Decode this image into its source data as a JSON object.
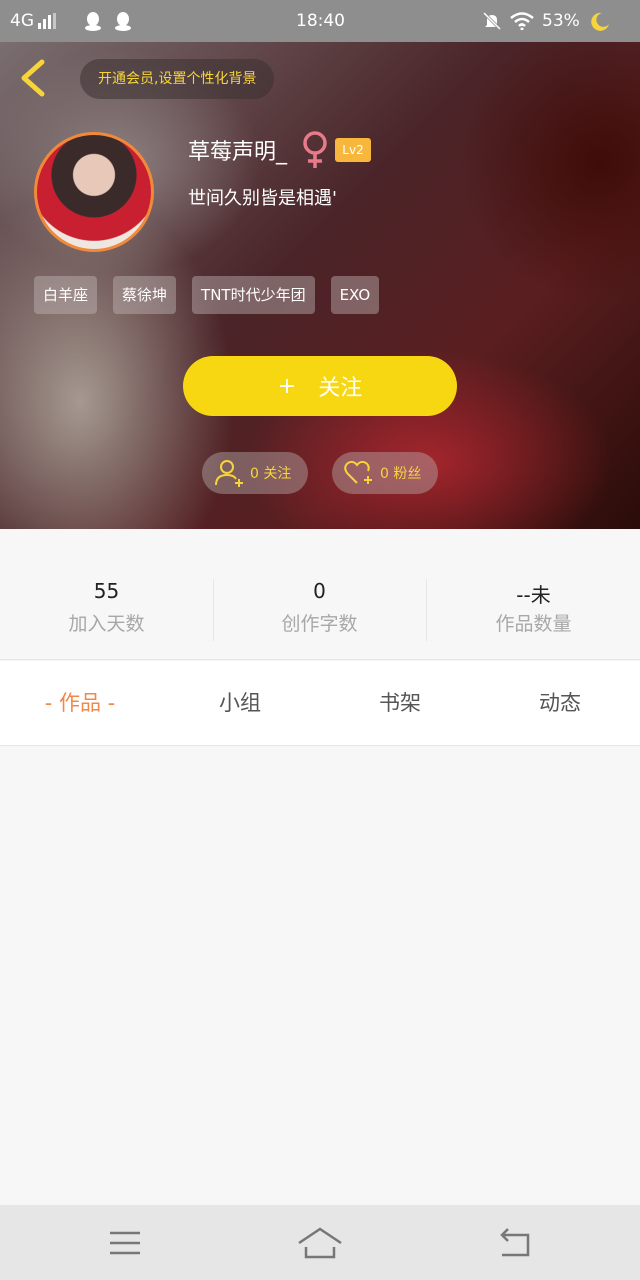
{
  "status_bar": {
    "network": "4G",
    "time": "18:40",
    "battery": "53%"
  },
  "header": {
    "vip_prompt": "开通会员,设置个性化背景"
  },
  "profile": {
    "username": "草莓声明_",
    "gender_symbol": "♀",
    "level": "Lv2",
    "bio": "世间久别皆是相遇'",
    "tags": [
      "白羊座",
      "蔡徐坤",
      "TNT时代少年团",
      "EXO"
    ]
  },
  "actions": {
    "follow_plus": "+",
    "follow_label": "关注",
    "following_label": "0 关注",
    "fans_label": "0 粉丝"
  },
  "stats": [
    {
      "value": "55",
      "label": "加入天数"
    },
    {
      "value": "0",
      "label": "创作字数"
    },
    {
      "value": "--未",
      "label": "作品数量"
    }
  ],
  "tabs": [
    "- 作品 -",
    "小组",
    "书架",
    "动态"
  ],
  "colors": {
    "accent_yellow": "#f7d712",
    "tab_active": "#f0884a",
    "avatar_border": "#f08a3a",
    "level_badge": "#f6b73c",
    "female_icon": "#e87a8a"
  }
}
